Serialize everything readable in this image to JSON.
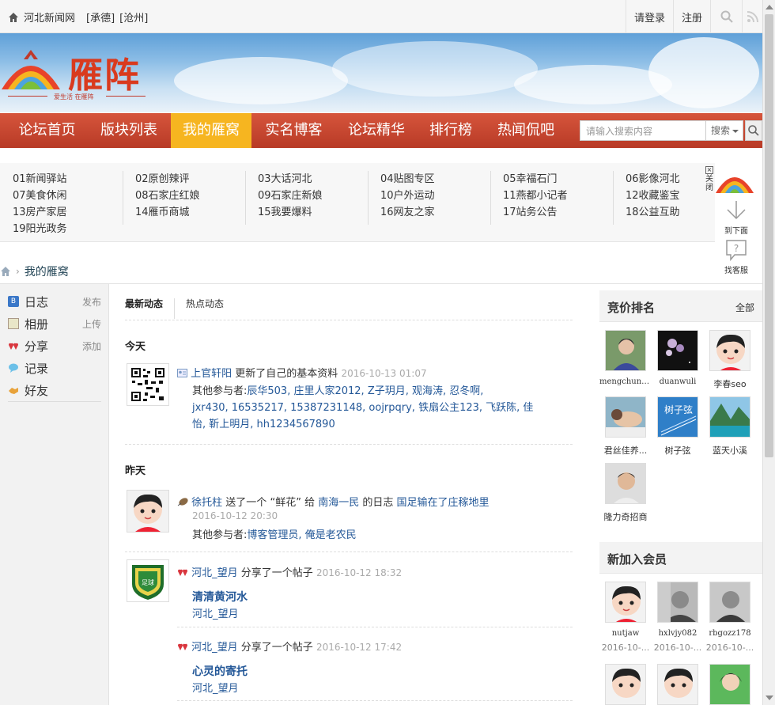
{
  "topbar": {
    "site_name": "河北新闻网",
    "city1": "[承德]",
    "city2": "[沧州]",
    "login": "请登录",
    "register": "注册"
  },
  "logo": {
    "name": "雁阵",
    "slogan": "爱生活  在雁阵"
  },
  "nav": {
    "items": [
      "论坛首页",
      "版块列表",
      "我的雁窝",
      "实名博客",
      "论坛精华",
      "排行榜",
      "热闻侃吧"
    ],
    "active_index": 2,
    "search_placeholder": "请输入搜索内容",
    "search_type": "搜索"
  },
  "forums": {
    "col1": [
      "01新闻驿站",
      "07美食休闲",
      "13房产家居",
      "19阳光政务"
    ],
    "col2": [
      "02原创辣评",
      "08石家庄红娘",
      "14雁币商城"
    ],
    "col3": [
      "03大话河北",
      "09石家庄新娘",
      "15我要爆料"
    ],
    "col4": [
      "04贴图专区",
      "10户外运动",
      "16网友之家"
    ],
    "col5": [
      "05幸福石门",
      "11燕都小记者",
      "17站务公告"
    ],
    "col6": [
      "06影像河北",
      "12收藏鉴宝",
      "18公益互助"
    ],
    "close": "关闭"
  },
  "float_tools": {
    "down": "到下面",
    "service": "找客服"
  },
  "breadcrumb": {
    "current": "我的雁窝"
  },
  "left_menu": [
    {
      "label": "日志",
      "action": "发布"
    },
    {
      "label": "相册",
      "action": "上传"
    },
    {
      "label": "分享",
      "action": "添加"
    },
    {
      "label": "记录",
      "action": ""
    },
    {
      "label": "好友",
      "action": ""
    }
  ],
  "tabs": [
    "最新动态",
    "热点动态"
  ],
  "days": {
    "today": "今天",
    "yesterday": "昨天"
  },
  "feed": {
    "f1": {
      "user": "上官轩阳",
      "action": "更新了自己的基本资料",
      "time": "2016-10-13 01:07",
      "others_label": "其他参与者:",
      "others1": "辰华503, 庄里人家2012, Z子玥月, 观海涛, 忍冬啊,",
      "others2": "jxr430, 16535217, 15387231148, oojrpqry, 铁扇公主123, 飞跃陈, 佳",
      "others3": "怡, 靳上明月, hh1234567890"
    },
    "f2": {
      "user": "徐托柱",
      "action1": "送了一个",
      "gift": "“鲜花”",
      "action2": "给",
      "target": "南海一民",
      "action3": "的日志",
      "post": "国足输在了庄稼地里",
      "time": "2016-10-12 20:30",
      "others_label": "其他参与者:",
      "others": "博客管理员, 俺是老农民"
    },
    "f3": {
      "user": "河北_望月",
      "action": "分享了一个帖子",
      "time": "2016-10-12 18:32",
      "title": "清清黄河水",
      "author": "河北_望月"
    },
    "f4": {
      "user": "河北_望月",
      "action": "分享了一个帖子",
      "time": "2016-10-12 17:42",
      "title": "心灵的寄托",
      "author": "河北_望月"
    }
  },
  "bid_rank": {
    "title": "竞价排名",
    "more": "全部",
    "members": [
      "mengchunzhi",
      "duanwuli",
      "李春seo",
      "君丝佳养...",
      "树子弦",
      "蓝天小溪",
      "隆力奇招商"
    ]
  },
  "new_members": {
    "title": "新加入会员",
    "members": [
      {
        "name": "nutjaw",
        "date": "2016-10-..."
      },
      {
        "name": "hxlvjy082",
        "date": "2016-10-..."
      },
      {
        "name": "rbgozz178",
        "date": "2016-10-..."
      }
    ]
  },
  "colors": {
    "nav_red": "#c9442e",
    "nav_active": "#f6b520",
    "link_blue": "#245898"
  }
}
